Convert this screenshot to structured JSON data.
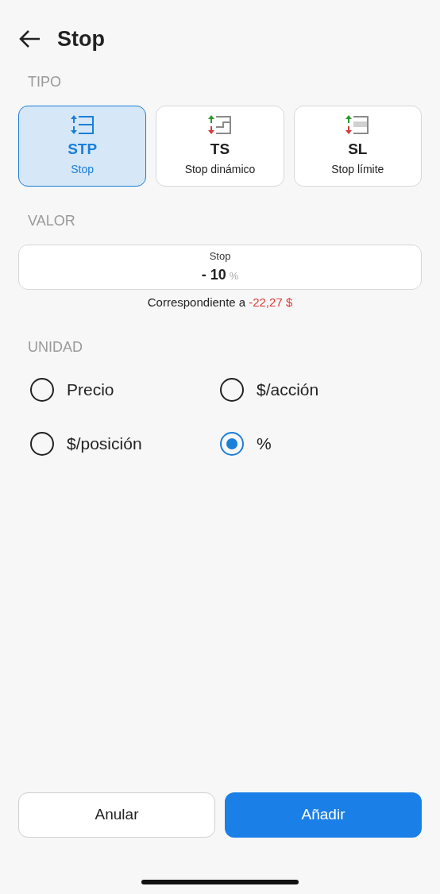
{
  "header": {
    "title": "Stop"
  },
  "type_section": {
    "heading": "TIPO",
    "options": [
      {
        "kind": "stp",
        "code": "STP",
        "label": "Stop",
        "selected": true
      },
      {
        "kind": "ts",
        "code": "TS",
        "label": "Stop dinámico",
        "selected": false
      },
      {
        "kind": "sl",
        "code": "SL",
        "label": "Stop límite",
        "selected": false
      }
    ]
  },
  "value_section": {
    "heading": "VALOR",
    "field": {
      "label": "Stop",
      "value": "- 10",
      "unit": "%"
    },
    "note": "Correspondiente a",
    "amount": "-22,27 $"
  },
  "unit_section": {
    "heading": "UNIDAD",
    "options": [
      {
        "label": "Precio",
        "selected": false
      },
      {
        "label": "$/acción",
        "selected": false
      },
      {
        "label": "$/posición",
        "selected": false
      },
      {
        "label": "%",
        "selected": true
      }
    ]
  },
  "buttons": [
    {
      "kind": "secondary",
      "label": "Anular"
    },
    {
      "kind": "primary",
      "label": "Añadir"
    }
  ]
}
